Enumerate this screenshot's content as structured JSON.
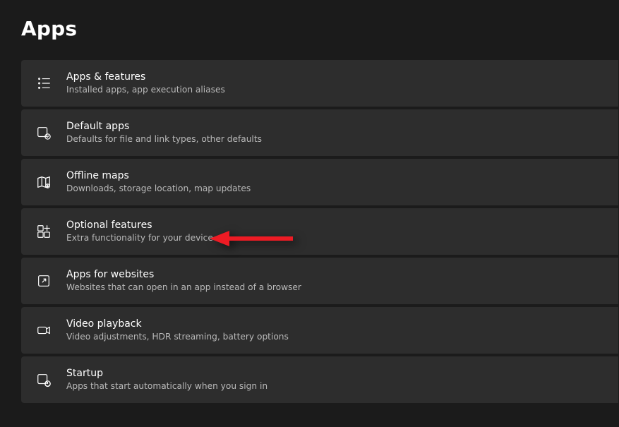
{
  "page": {
    "title": "Apps"
  },
  "cards": {
    "apps_features": {
      "title": "Apps & features",
      "sub": "Installed apps, app execution aliases"
    },
    "default_apps": {
      "title": "Default apps",
      "sub": "Defaults for file and link types, other defaults"
    },
    "offline_maps": {
      "title": "Offline maps",
      "sub": "Downloads, storage location, map updates"
    },
    "optional_features": {
      "title": "Optional features",
      "sub": "Extra functionality for your device"
    },
    "apps_for_websites": {
      "title": "Apps for websites",
      "sub": "Websites that can open in an app instead of a browser"
    },
    "video_playback": {
      "title": "Video playback",
      "sub": "Video adjustments, HDR streaming, battery options"
    },
    "startup": {
      "title": "Startup",
      "sub": "Apps that start automatically when you sign in"
    }
  }
}
